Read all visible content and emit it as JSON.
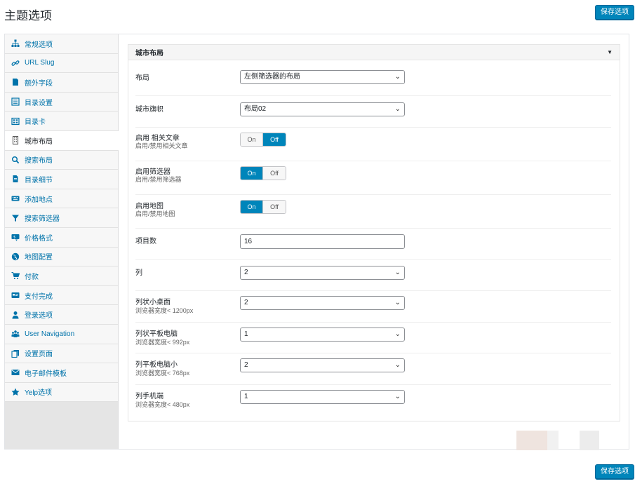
{
  "page": {
    "title": "主题选项",
    "save_label": "保存选项"
  },
  "sidebar": {
    "items": [
      {
        "label": "常规选项",
        "icon": "sitemap-icon"
      },
      {
        "label": "URL Slug",
        "icon": "link-icon"
      },
      {
        "label": "额外字段",
        "icon": "document-icon"
      },
      {
        "label": "目录设置",
        "icon": "list-icon"
      },
      {
        "label": "目录卡",
        "icon": "grid-icon"
      },
      {
        "label": "城市布局",
        "icon": "building-icon"
      },
      {
        "label": "搜索布局",
        "icon": "search-icon"
      },
      {
        "label": "目录细节",
        "icon": "file-icon"
      },
      {
        "label": "添加地点",
        "icon": "keyboard-icon"
      },
      {
        "label": "搜索筛选器",
        "icon": "filter-icon"
      },
      {
        "label": "价格格式",
        "icon": "price-icon"
      },
      {
        "label": "地图配置",
        "icon": "globe-icon"
      },
      {
        "label": "付款",
        "icon": "cart-icon"
      },
      {
        "label": "支付完成",
        "icon": "card-icon"
      },
      {
        "label": "登录选项",
        "icon": "user-icon"
      },
      {
        "label": "User Navigation",
        "icon": "users-icon"
      },
      {
        "label": "设置页面",
        "icon": "copy-icon"
      },
      {
        "label": "电子邮件模板",
        "icon": "mail-icon"
      },
      {
        "label": "Yelp选项",
        "icon": "star-icon"
      }
    ],
    "active_index": 5
  },
  "section": {
    "title": "城市布局"
  },
  "fields": {
    "layout": {
      "label": "布局",
      "value": "左侧筛选器的布局"
    },
    "city_banner": {
      "label": "城市旗帜",
      "value": "布局02"
    },
    "related_posts": {
      "label": "启用 相关文章",
      "desc": "启用/禁用相关文章",
      "on": "On",
      "off": "Off",
      "state": "off"
    },
    "enable_filter": {
      "label": "启用筛选器",
      "desc": "启用/禁用筛选器",
      "on": "On",
      "off": "Off",
      "state": "on"
    },
    "enable_map": {
      "label": "启用地图",
      "desc": "启用/禁用地图",
      "on": "On",
      "off": "Off",
      "state": "on"
    },
    "items_count": {
      "label": "项目数",
      "value": "16"
    },
    "columns": {
      "label": "列",
      "value": "2"
    },
    "col_desktop_small": {
      "label": "列状小桌面",
      "desc": "浏览器宽度< 1200px",
      "value": "2"
    },
    "col_tablet": {
      "label": "列状平板电脑",
      "desc": "浏览器宽度< 992px",
      "value": "1"
    },
    "col_tablet_small": {
      "label": "列平板电脑小",
      "desc": "浏览器宽度< 768px",
      "value": "2"
    },
    "col_mobile": {
      "label": "列手机端",
      "desc": "浏览器宽度< 480px",
      "value": "1"
    }
  }
}
